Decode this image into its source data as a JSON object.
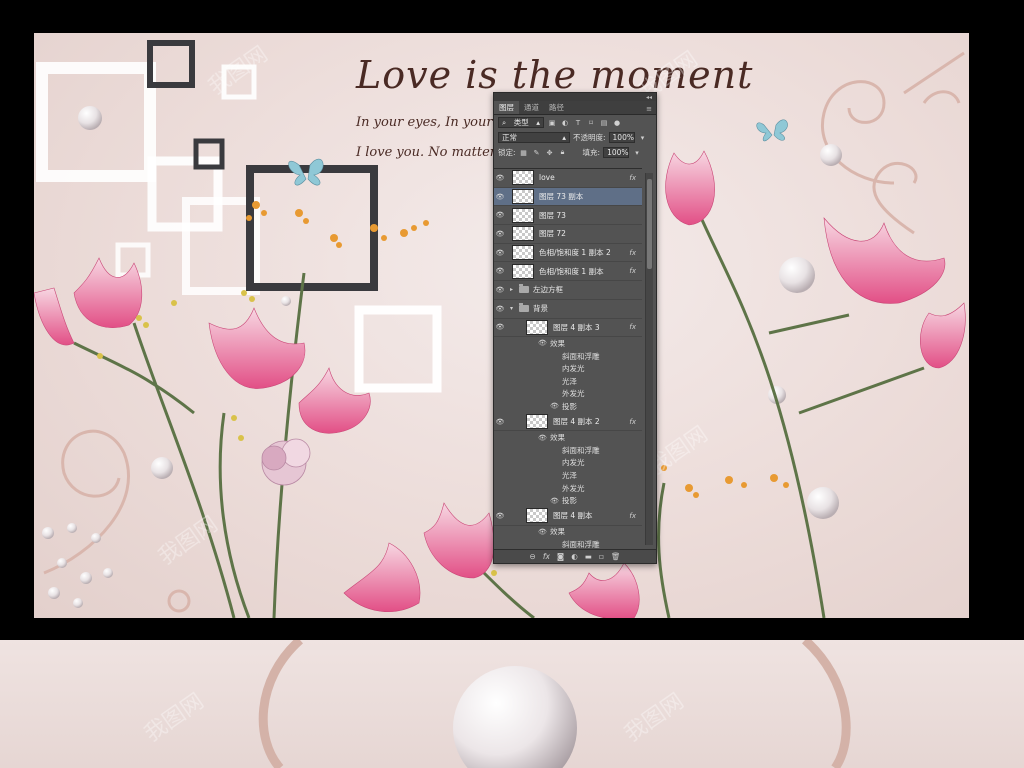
{
  "artwork": {
    "title": "Love is the moment",
    "line1": "In your eyes, In your m",
    "line2": "I love you. No matter"
  },
  "watermark": "我图网",
  "panel": {
    "tabs": [
      "图层",
      "通道",
      "路径"
    ],
    "filter_kind": "类型",
    "blend_mode": "正常",
    "opacity_label": "不透明度:",
    "opacity_value": "100%",
    "lock_label": "锁定:",
    "fill_label": "填充:",
    "fill_value": "100%",
    "layers": [
      {
        "name": "love",
        "fx": "fx",
        "type": "layer",
        "selected": false
      },
      {
        "name": "图层 73 副本",
        "fx": "",
        "type": "layer",
        "selected": true
      },
      {
        "name": "图层 73",
        "fx": "",
        "type": "layer",
        "selected": false
      },
      {
        "name": "图层 72",
        "fx": "",
        "type": "layer",
        "selected": false
      },
      {
        "name": "色相/饱和度 1 副本 2",
        "fx": "fx",
        "type": "layer",
        "selected": false
      },
      {
        "name": "色相/饱和度 1 副本",
        "fx": "fx",
        "type": "layer",
        "selected": false
      },
      {
        "name": "左边方框",
        "fx": "",
        "type": "group-closed",
        "selected": false
      },
      {
        "name": "背景",
        "fx": "",
        "type": "group-open",
        "selected": false
      },
      {
        "name": "图层 4 副本 3",
        "fx": "fx",
        "type": "sublayer",
        "selected": false,
        "effects_label": "效果",
        "effects": [
          "斜面和浮雕",
          "内发光",
          "光泽",
          "外发光"
        ],
        "shadow": "投影"
      },
      {
        "name": "图层 4 副本 2",
        "fx": "fx",
        "type": "sublayer",
        "selected": false,
        "effects_label": "效果",
        "effects": [
          "斜面和浮雕",
          "内发光",
          "光泽",
          "外发光"
        ],
        "shadow": "投影"
      },
      {
        "name": "图层 4 副本",
        "fx": "fx",
        "type": "sublayer",
        "selected": false,
        "effects_label": "效果",
        "effects": [
          "斜面和浮雕"
        ],
        "shadow": ""
      }
    ],
    "bottom_icons": [
      "link-icon",
      "fx-icon",
      "mask-icon",
      "adjustment-icon",
      "folder-icon",
      "new-layer-icon",
      "trash-icon"
    ]
  }
}
